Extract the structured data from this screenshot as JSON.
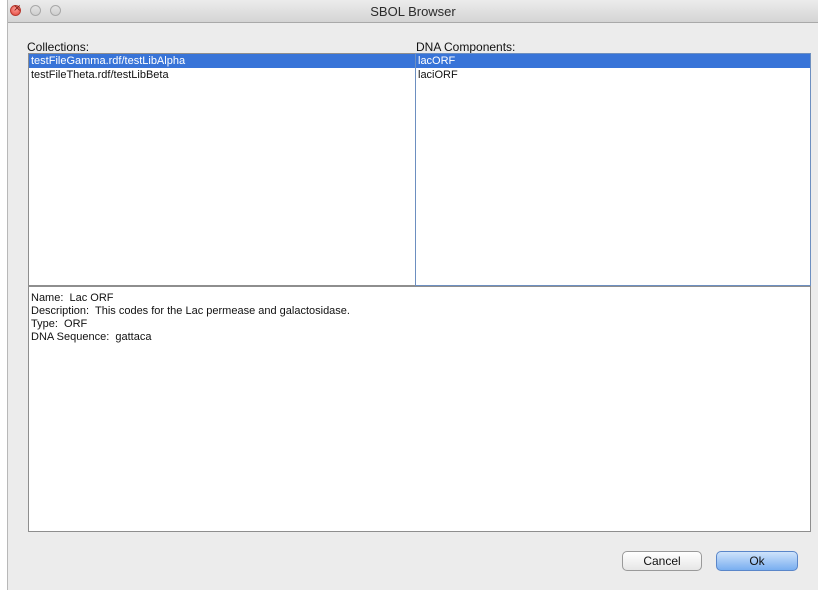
{
  "window": {
    "title": "SBOL Browser"
  },
  "collections": {
    "label": "Collections:",
    "items": [
      {
        "label": "testFileGamma.rdf/testLibAlpha",
        "selected": true
      },
      {
        "label": "testFileTheta.rdf/testLibBeta",
        "selected": false
      }
    ]
  },
  "components": {
    "label": "DNA Components:",
    "items": [
      {
        "label": "lacORF",
        "selected": true
      },
      {
        "label": "laciORF",
        "selected": false
      }
    ]
  },
  "details": {
    "name": "Name:  Lac ORF",
    "description": "Description:  This codes for the Lac permease and galactosidase.",
    "type": "Type:  ORF",
    "sequence": "DNA Sequence:  gattaca"
  },
  "buttons": {
    "cancel": "Cancel",
    "ok": "Ok"
  },
  "colors": {
    "selection": "#3874d8",
    "ok_button": "#79aef0"
  }
}
